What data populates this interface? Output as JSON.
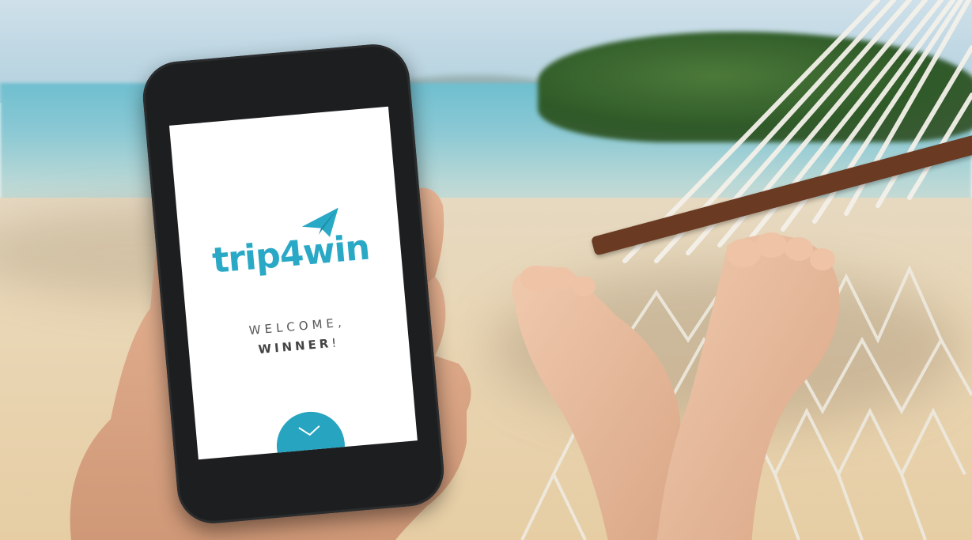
{
  "app": {
    "brand": "trip4win",
    "welcome_line": "WELCOME,",
    "winner_word": "WINNER",
    "winner_punct": "!"
  },
  "colors": {
    "brand": "#2aa9c6",
    "button": "#27a5c0",
    "screen_bg": "#ffffff",
    "phone_body": "#1d1e20",
    "hammock_bar": "#6b3a22"
  },
  "icons": {
    "logo_mark": "paper-plane-icon",
    "enter": "chevron-down-icon"
  }
}
